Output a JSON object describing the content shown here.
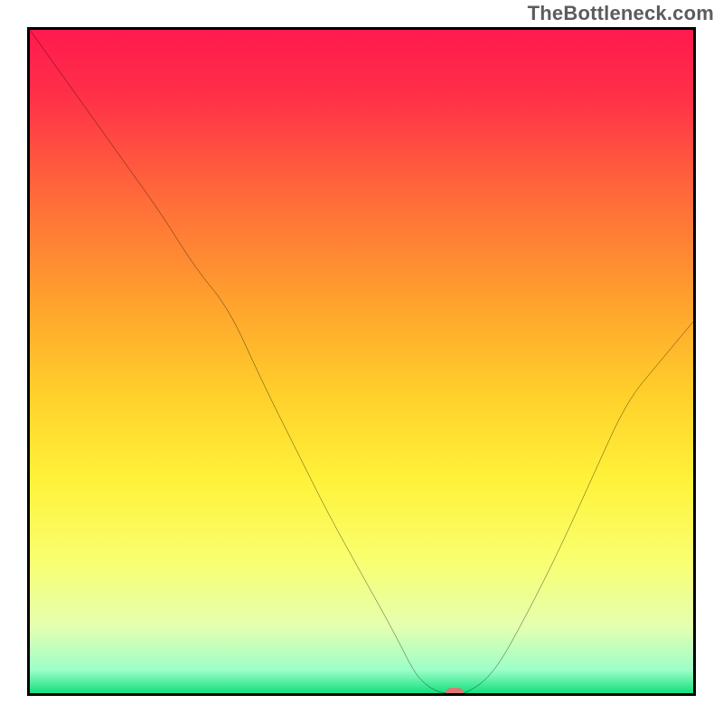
{
  "watermark": "TheBottleneck.com",
  "chart_data": {
    "type": "line",
    "title": "",
    "xlabel": "",
    "ylabel": "",
    "xlim": [
      0,
      100
    ],
    "ylim": [
      0,
      100
    ],
    "grid": false,
    "legend": false,
    "series": [
      {
        "name": "bottleneck-curve",
        "color": "#000000",
        "x": [
          0,
          5,
          10,
          15,
          20,
          25,
          30,
          35,
          40,
          45,
          50,
          55,
          58,
          60,
          62,
          64,
          66,
          70,
          75,
          80,
          85,
          90,
          95,
          100
        ],
        "y": [
          100,
          93,
          86,
          79,
          72,
          64,
          58,
          47,
          37,
          27,
          18,
          9,
          3,
          1,
          0,
          0,
          0,
          3,
          12,
          22,
          33,
          44,
          50,
          56
        ]
      }
    ],
    "marker": {
      "name": "current-point",
      "x": 64,
      "y": 0,
      "color": "#d77a73"
    },
    "background_gradient": {
      "stops": [
        {
          "offset": 0.0,
          "color": "#ff1a4e"
        },
        {
          "offset": 0.1,
          "color": "#ff3048"
        },
        {
          "offset": 0.25,
          "color": "#ff6a3a"
        },
        {
          "offset": 0.4,
          "color": "#ff9e2e"
        },
        {
          "offset": 0.55,
          "color": "#ffd02a"
        },
        {
          "offset": 0.68,
          "color": "#fff23a"
        },
        {
          "offset": 0.8,
          "color": "#f9ff70"
        },
        {
          "offset": 0.9,
          "color": "#e4ffb0"
        },
        {
          "offset": 0.965,
          "color": "#9cffc8"
        },
        {
          "offset": 1.0,
          "color": "#14e07e"
        }
      ]
    }
  }
}
